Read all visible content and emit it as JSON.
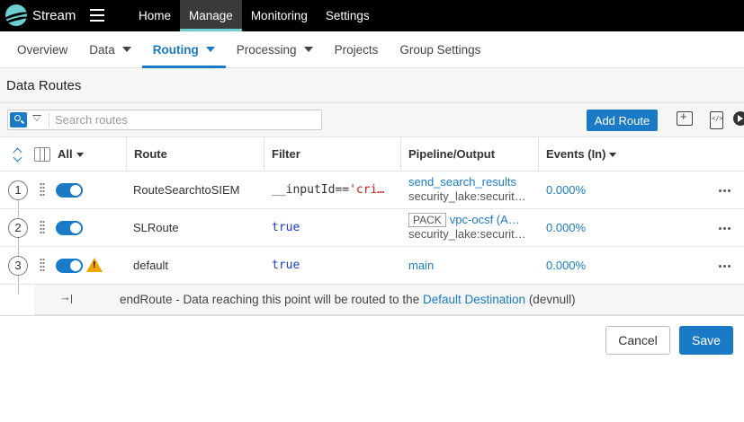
{
  "app": {
    "brand": "Stream"
  },
  "topnav": [
    "Home",
    "Manage",
    "Monitoring",
    "Settings"
  ],
  "subnav": {
    "overview": "Overview",
    "data": "Data",
    "routing": "Routing",
    "processing": "Processing",
    "projects": "Projects",
    "group_settings": "Group Settings"
  },
  "page": {
    "title": "Data Routes"
  },
  "toolbar": {
    "search_placeholder": "Search routes",
    "add_route": "Add Route"
  },
  "table": {
    "headers": {
      "all": "All",
      "route": "Route",
      "filter": "Filter",
      "pipeline": "Pipeline/Output",
      "events": "Events (In)"
    },
    "rows": [
      {
        "num": "1",
        "enabled": true,
        "route": "RouteSearchtoSIEM",
        "filter_lead": "__inputId==",
        "filter_str": "'cri…",
        "pipeline": "send_search_results",
        "output": "security_lake:securit…",
        "events": "0.000%"
      },
      {
        "num": "2",
        "enabled": true,
        "route": "SLRoute",
        "filter": "true",
        "pack": "PACK",
        "pipeline": "vpc-ocsf (A…",
        "output": "security_lake:securit…",
        "events": "0.000%"
      },
      {
        "num": "3",
        "enabled": true,
        "warning": true,
        "route": "default",
        "filter": "true",
        "pipeline": "main",
        "events": "0.000%"
      }
    ]
  },
  "end_route": {
    "text": "endRoute - Data reaching this point will be routed to the",
    "link": "Default Destination",
    "suffix": "(devnull)"
  },
  "footer": {
    "cancel": "Cancel",
    "save": "Save"
  },
  "colors": {
    "accent": "#1a7ac6",
    "teal": "#6fd0d3",
    "warning": "#f0a500"
  }
}
